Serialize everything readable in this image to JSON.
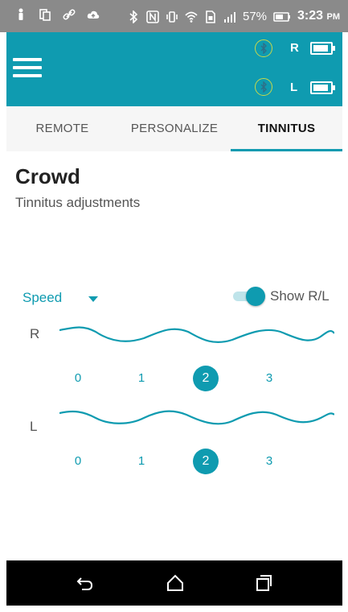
{
  "status_bar": {
    "battery_percent": "57%",
    "time": "3:23",
    "ampm": "PM"
  },
  "app_bar": {
    "right_label": "R",
    "left_label": "L",
    "right_battery_level": 0.75,
    "left_battery_level": 0.75
  },
  "tabs": [
    {
      "label": "REMOTE",
      "active": false
    },
    {
      "label": "PERSONALIZE",
      "active": false
    },
    {
      "label": "TINNITUS",
      "active": true
    }
  ],
  "content": {
    "title": "Crowd",
    "subtitle": "Tinnitus adjustments",
    "dropdown_value": "Speed",
    "toggle_label": "Show R/L",
    "toggle_on": true,
    "right": {
      "label": "R",
      "options": [
        "0",
        "1",
        "2",
        "3"
      ],
      "selected": "2"
    },
    "left": {
      "label": "L",
      "options": [
        "0",
        "1",
        "2",
        "3"
      ],
      "selected": "2"
    }
  },
  "colors": {
    "accent": "#0f9bb0",
    "status_bar": "#8a8a8a",
    "bluetooth_ring": "#c8d84a"
  },
  "icons": {
    "menu": "hamburger-menu-icon",
    "bluetooth": "bluetooth-icon",
    "battery": "battery-icon",
    "back": "back-icon",
    "home": "home-icon",
    "recents": "recents-icon"
  }
}
